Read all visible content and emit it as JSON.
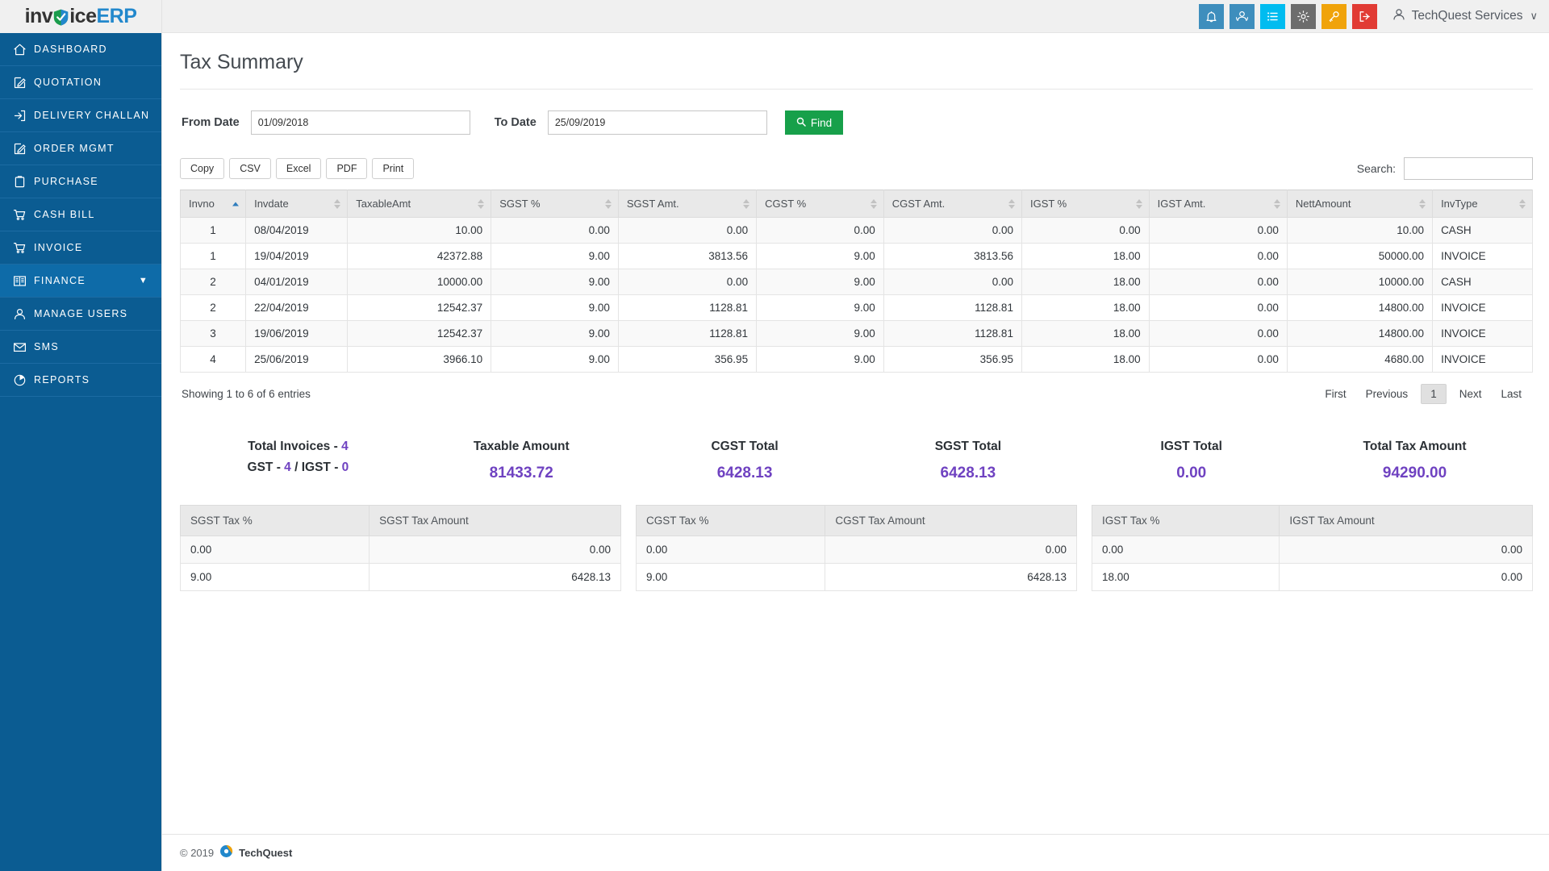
{
  "brand": {
    "part1": "inv",
    "part2": "ice",
    "part3": "ERP"
  },
  "sidebar": {
    "items": [
      {
        "label": "DASHBOARD",
        "icon": "home-icon"
      },
      {
        "label": "QUOTATION",
        "icon": "edit-document-icon"
      },
      {
        "label": "DELIVERY CHALLAN",
        "icon": "login-arrow-icon"
      },
      {
        "label": "ORDER MGMT",
        "icon": "edit-document-icon"
      },
      {
        "label": "PURCHASE",
        "icon": "clipboard-icon"
      },
      {
        "label": "CASH BILL",
        "icon": "cart-icon"
      },
      {
        "label": "INVOICE",
        "icon": "cart-icon"
      },
      {
        "label": "FINANCE",
        "icon": "book-icon",
        "caret": "▼",
        "active": true
      },
      {
        "label": "MANAGE USERS",
        "icon": "user-icon"
      },
      {
        "label": "SMS",
        "icon": "envelope-icon"
      },
      {
        "label": "REPORTS",
        "icon": "pie-chart-icon"
      }
    ]
  },
  "topbar": {
    "buttons": [
      {
        "name": "bell-icon",
        "color": "#3e8ebd"
      },
      {
        "name": "users-icon",
        "color": "#3e8ebd"
      },
      {
        "name": "list-icon",
        "color": "#00bcf0"
      },
      {
        "name": "gear-icon",
        "color": "#6d6d6d"
      },
      {
        "name": "key-icon",
        "color": "#f0a30a"
      },
      {
        "name": "logout-icon",
        "color": "#e13b34"
      }
    ],
    "user_name": "TechQuest Services",
    "user_caret": "∨"
  },
  "page": {
    "title": "Tax Summary"
  },
  "filters": {
    "from_label": "From Date",
    "from_value": "01/09/2018",
    "to_label": "To Date",
    "to_value": "25/09/2019",
    "find_label": "Find"
  },
  "tools": {
    "export": [
      "Copy",
      "CSV",
      "Excel",
      "PDF",
      "Print"
    ],
    "search_label": "Search:",
    "search_value": ""
  },
  "table": {
    "columns": [
      "Invno",
      "Invdate",
      "TaxableAmt",
      "SGST %",
      "SGST Amt.",
      "CGST %",
      "CGST Amt.",
      "IGST %",
      "IGST Amt.",
      "NettAmount",
      "InvType"
    ],
    "sorted_column": 0,
    "sort_direction": "asc",
    "rows": [
      [
        "1",
        "08/04/2019",
        "10.00",
        "0.00",
        "0.00",
        "0.00",
        "0.00",
        "0.00",
        "0.00",
        "10.00",
        "CASH"
      ],
      [
        "1",
        "19/04/2019",
        "42372.88",
        "9.00",
        "3813.56",
        "9.00",
        "3813.56",
        "18.00",
        "0.00",
        "50000.00",
        "INVOICE"
      ],
      [
        "2",
        "04/01/2019",
        "10000.00",
        "9.00",
        "0.00",
        "9.00",
        "0.00",
        "18.00",
        "0.00",
        "10000.00",
        "CASH"
      ],
      [
        "2",
        "22/04/2019",
        "12542.37",
        "9.00",
        "1128.81",
        "9.00",
        "1128.81",
        "18.00",
        "0.00",
        "14800.00",
        "INVOICE"
      ],
      [
        "3",
        "19/06/2019",
        "12542.37",
        "9.00",
        "1128.81",
        "9.00",
        "1128.81",
        "18.00",
        "0.00",
        "14800.00",
        "INVOICE"
      ],
      [
        "4",
        "25/06/2019",
        "3966.10",
        "9.00",
        "356.95",
        "9.00",
        "356.95",
        "18.00",
        "0.00",
        "4680.00",
        "INVOICE"
      ]
    ]
  },
  "pagination": {
    "info": "Showing 1 to 6 of 6 entries",
    "first": "First",
    "previous": "Previous",
    "current_page": "1",
    "next": "Next",
    "last": "Last"
  },
  "totals": {
    "invoices_label": "Total Invoices - ",
    "invoices_value": "4",
    "gst_prefix": "GST - ",
    "gst_value": "4",
    "gst_sep": " / IGST - ",
    "igst_value": "0",
    "cells": [
      {
        "title": "Taxable Amount",
        "value": "81433.72"
      },
      {
        "title": "CGST Total",
        "value": "6428.13"
      },
      {
        "title": "SGST Total",
        "value": "6428.13"
      },
      {
        "title": "IGST Total",
        "value": "0.00"
      },
      {
        "title": "Total Tax Amount",
        "value": "94290.00"
      }
    ]
  },
  "tax_tables": [
    {
      "headers": [
        "SGST Tax %",
        "SGST Tax Amount"
      ],
      "rows": [
        [
          "0.00",
          "0.00"
        ],
        [
          "9.00",
          "6428.13"
        ]
      ]
    },
    {
      "headers": [
        "CGST Tax %",
        "CGST Tax Amount"
      ],
      "rows": [
        [
          "0.00",
          "0.00"
        ],
        [
          "9.00",
          "6428.13"
        ]
      ]
    },
    {
      "headers": [
        "IGST Tax %",
        "IGST Tax Amount"
      ],
      "rows": [
        [
          "0.00",
          "0.00"
        ],
        [
          "18.00",
          "0.00"
        ]
      ]
    }
  ],
  "footer": {
    "copyright": "© 2019",
    "brand": "TechQuest"
  }
}
